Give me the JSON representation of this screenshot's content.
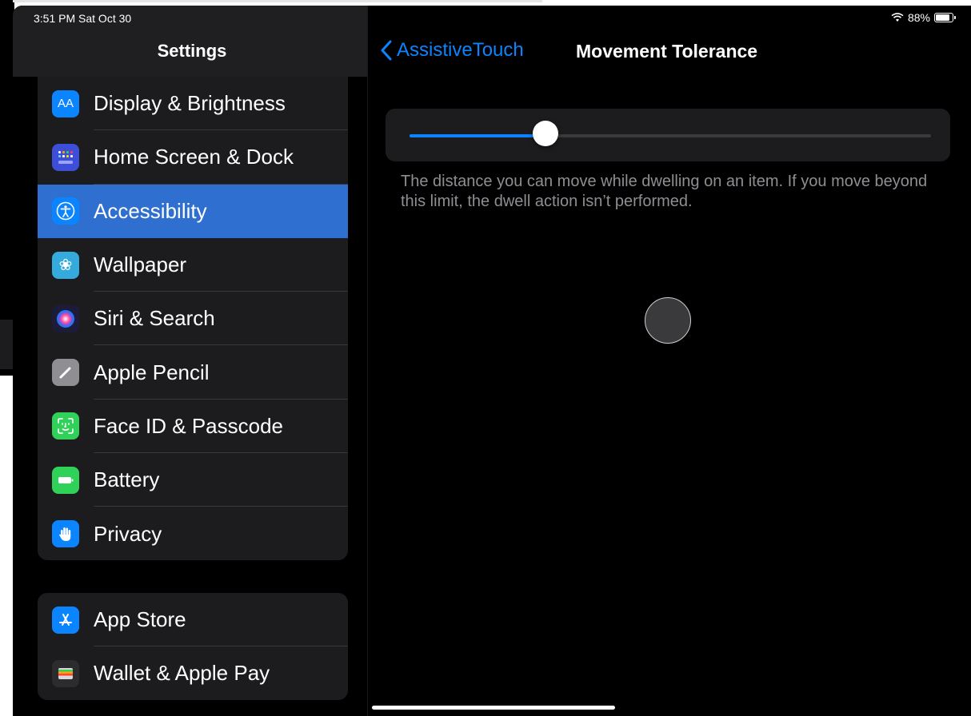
{
  "status": {
    "time": "3:51 PM  Sat Oct 30",
    "battery": "88%"
  },
  "sidebar": {
    "title": "Settings",
    "group1": [
      {
        "label": "Display & Brightness",
        "icon": "display-brightness-icon",
        "color": "#0a84ff",
        "glyph": "AA"
      },
      {
        "label": "Home Screen & Dock",
        "icon": "home-screen-icon",
        "color": "#3d4ed8",
        "glyph": ""
      },
      {
        "label": "Accessibility",
        "icon": "accessibility-icon",
        "color": "#0a84ff",
        "glyph": "",
        "selected": true
      },
      {
        "label": "Wallpaper",
        "icon": "wallpaper-icon",
        "color": "#35aadc",
        "glyph": "❀"
      },
      {
        "label": "Siri & Search",
        "icon": "siri-icon",
        "color": "#1c1c3a",
        "glyph": ""
      },
      {
        "label": "Apple Pencil",
        "icon": "pencil-icon",
        "color": "#8e8e93",
        "glyph": "✎"
      },
      {
        "label": "Face ID & Passcode",
        "icon": "face-id-icon",
        "color": "#30d158",
        "glyph": "☺"
      },
      {
        "label": "Battery",
        "icon": "battery-icon",
        "color": "#30d158",
        "glyph": ""
      },
      {
        "label": "Privacy",
        "icon": "privacy-icon",
        "color": "#0a84ff",
        "glyph": "✋"
      }
    ],
    "group2": [
      {
        "label": "App Store",
        "icon": "app-store-icon",
        "color": "#0a84ff",
        "glyph": "A"
      },
      {
        "label": "Wallet & Apple Pay",
        "icon": "wallet-icon",
        "color": "#2c2c2e",
        "glyph": ""
      }
    ]
  },
  "detail": {
    "back_label": "AssistiveTouch",
    "title": "Movement Tolerance",
    "slider_value": 0.26,
    "description": "The distance you can move while dwelling on an item. If you move beyond this limit, the dwell action isn’t performed."
  },
  "colors": {
    "accent": "#0a84ff",
    "selected_row": "#2f6fcf"
  }
}
